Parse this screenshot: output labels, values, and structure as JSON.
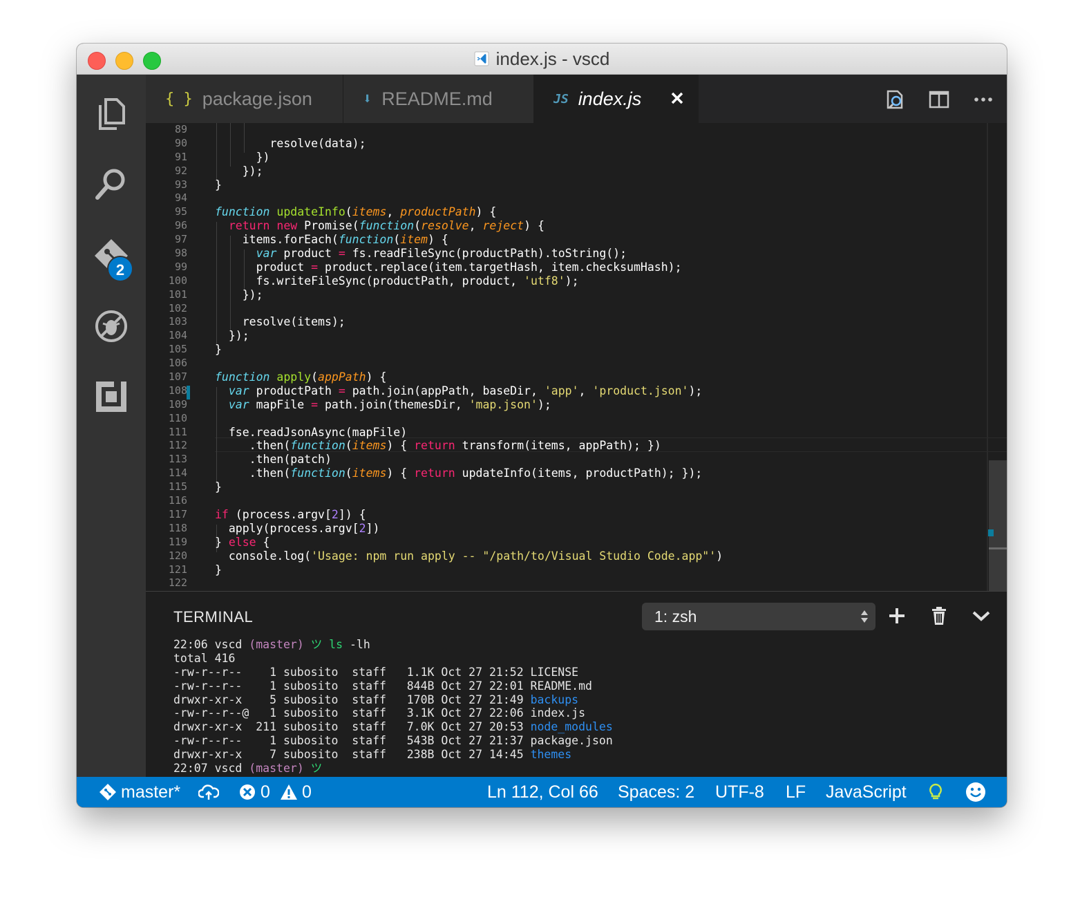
{
  "window": {
    "title": "index.js - vscd"
  },
  "activity": {
    "scm_badge": "2"
  },
  "tabs": [
    {
      "icon": "{ }",
      "label": "package.json"
    },
    {
      "icon": "⬇",
      "label": "README.md"
    },
    {
      "icon": "JS",
      "label": "index.js"
    }
  ],
  "editor": {
    "line_numbers": [
      "89",
      "90",
      "91",
      "92",
      "93",
      "94",
      "95",
      "96",
      "97",
      "98",
      "99",
      "100",
      "101",
      "102",
      "103",
      "104",
      "105",
      "106",
      "107",
      "108",
      "109",
      "110",
      "111",
      "112",
      "113",
      "114",
      "115",
      "116",
      "117",
      "118",
      "119",
      "120",
      "121",
      "122"
    ],
    "lines": [
      "",
      "        resolve(data);",
      "      })",
      "    });",
      "}",
      "",
      "function updateInfo(items, productPath) {",
      "  return new Promise(function(resolve, reject) {",
      "    items.forEach(function(item) {",
      "      var product = fs.readFileSync(productPath).toString();",
      "      product = product.replace(item.targetHash, item.checksumHash);",
      "      fs.writeFileSync(productPath, product, 'utf8');",
      "    });",
      "",
      "    resolve(items);",
      "  });",
      "}",
      "",
      "function apply(appPath) {",
      "  var productPath = path.join(appPath, baseDir, 'app', 'product.json');",
      "  var mapFile = path.join(themesDir, 'map.json');",
      "",
      "  fse.readJsonAsync(mapFile)",
      "     .then(function(items) { return transform(items, appPath); })",
      "     .then(patch)",
      "     .then(function(items) { return updateInfo(items, productPath); });",
      "}",
      "",
      "if (process.argv[2]) {",
      "  apply(process.argv[2])",
      "} else {",
      "  console.log('Usage: npm run apply -- \"/path/to/Visual Studio Code.app\"')",
      "}",
      ""
    ]
  },
  "panel": {
    "title": "TERMINAL",
    "terminal_select": "1: zsh",
    "lines": [
      "22:06 vscd (master) ツ ls -lh",
      "total 416",
      "-rw-r--r--    1 subosito  staff   1.1K Oct 27 21:52 LICENSE",
      "-rw-r--r--    1 subosito  staff   844B Oct 27 22:01 README.md",
      "drwxr-xr-x    5 subosito  staff   170B Oct 27 21:49 backups",
      "-rw-r--r--@   1 subosito  staff   3.1K Oct 27 22:06 index.js",
      "drwxr-xr-x  211 subosito  staff   7.0K Oct 27 20:53 node_modules",
      "-rw-r--r--    1 subosito  staff   543B Oct 27 21:37 package.json",
      "drwxr-xr-x    7 subosito  staff   238B Oct 27 14:45 themes",
      "22:07 vscd (master) ツ"
    ]
  },
  "status": {
    "branch": "master*",
    "errors": "0",
    "warnings": "0",
    "position": "Ln 112, Col 66",
    "spaces": "Spaces: 2",
    "encoding": "UTF-8",
    "eol": "LF",
    "language": "JavaScript"
  },
  "colors": {
    "statusbar": "#007acc",
    "editor_bg": "#1e1e1e",
    "activitybar": "#333333",
    "keyword": "#66d9ef",
    "control": "#f92672",
    "function_name": "#a6e22e",
    "parameter": "#fd971f",
    "string": "#e6db74",
    "number": "#ae81ff"
  }
}
